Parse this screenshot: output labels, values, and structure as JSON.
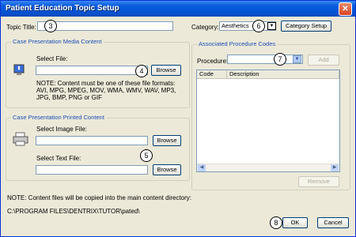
{
  "window": {
    "title": "Patient Education Topic Setup",
    "close_glyph": "✕"
  },
  "topic": {
    "label": "Topic Title:",
    "value": ""
  },
  "category": {
    "label": "Category:",
    "value": "Aesthetics",
    "setup_button": "Category Setup"
  },
  "media": {
    "legend": "Case Presentation Media Content",
    "select_label": "Select File:",
    "file_value": "",
    "browse": "Browse",
    "note_line1": "NOTE: Content must be one of these file formats:",
    "note_line2": "AVI, MPG, MPEG, MOV, WMA, WMV, WAV, MP3,",
    "note_line3": "JPG, BMP, PNG or GIF"
  },
  "printed": {
    "legend": "Case Presentation Printed Content",
    "image_label": "Select Image File:",
    "image_value": "",
    "text_label": "Select Text File:",
    "text_value": "",
    "browse": "Browse"
  },
  "procedures": {
    "legend": "Associated Procedure Codes",
    "label": "Procedure:",
    "value": "",
    "add": "Add",
    "columns": [
      "Code",
      "Description"
    ],
    "remove": "Remove"
  },
  "footer": {
    "note": "NOTE:  Content files will be copied into the main content directory:",
    "path": "C:\\PROGRAM FILES\\DENTRIX\\TUTOR\\pated\\",
    "ok": "OK",
    "cancel": "Cancel"
  },
  "callouts": [
    "3",
    "4",
    "5",
    "6",
    "7",
    "8"
  ],
  "colors": {
    "title_bar": "#0554d5",
    "legend_text": "#1b4fb7",
    "dialog_bg": "#ece9d8"
  }
}
